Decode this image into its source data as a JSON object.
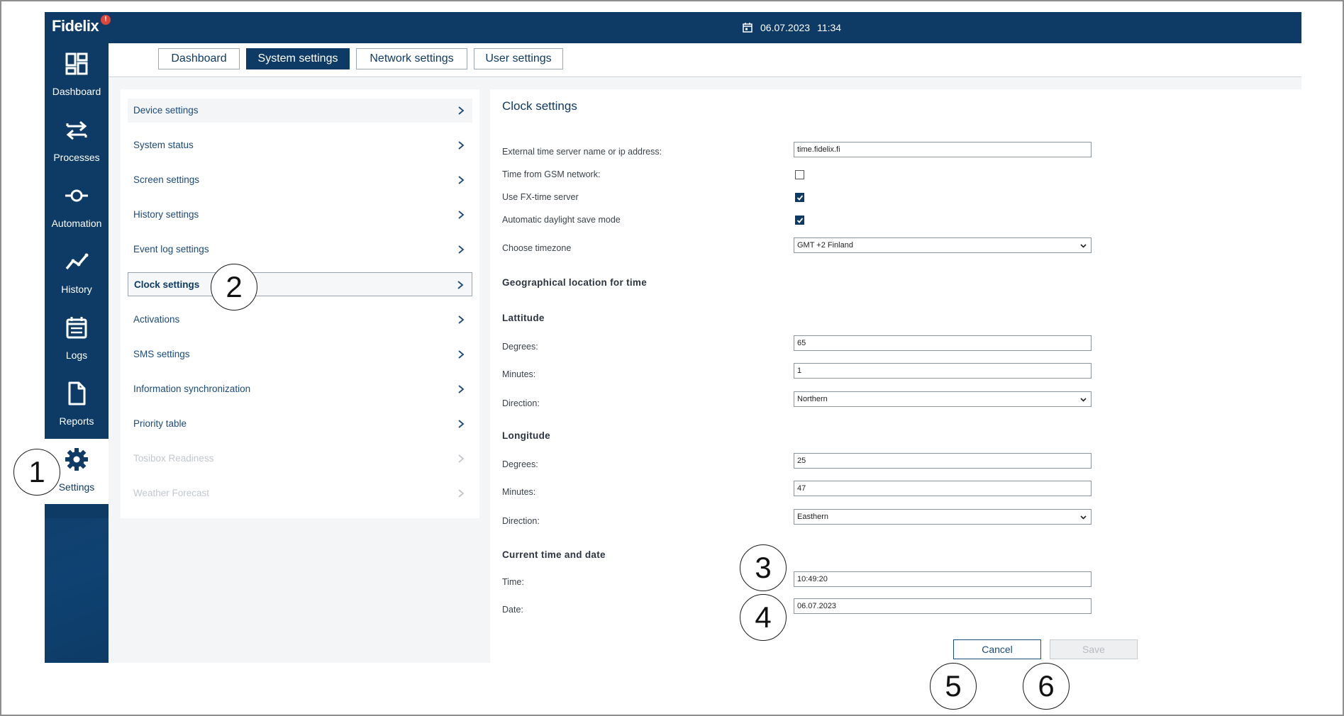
{
  "app": {
    "brand": "Fidelix",
    "alert_badge": "!",
    "date": "06.07.2023",
    "time": "11:34"
  },
  "sidebar": {
    "items": [
      {
        "label": "Dashboard",
        "icon": "dashboard-icon"
      },
      {
        "label": "Processes",
        "icon": "processes-icon"
      },
      {
        "label": "Automation",
        "icon": "automation-icon"
      },
      {
        "label": "History",
        "icon": "history-icon"
      },
      {
        "label": "Logs",
        "icon": "logs-icon"
      },
      {
        "label": "Reports",
        "icon": "reports-icon"
      },
      {
        "label": "Settings",
        "icon": "gear-icon",
        "active": true
      }
    ]
  },
  "tabs": [
    {
      "label": "Dashboard"
    },
    {
      "label": "System settings",
      "active": true
    },
    {
      "label": "Network settings"
    },
    {
      "label": "User settings"
    }
  ],
  "settings_menu": {
    "items": [
      {
        "label": "Device settings"
      },
      {
        "label": "System status"
      },
      {
        "label": "Screen settings"
      },
      {
        "label": "History settings"
      },
      {
        "label": "Event log settings"
      },
      {
        "label": "Clock settings",
        "active": true
      },
      {
        "label": "Activations"
      },
      {
        "label": "SMS settings"
      },
      {
        "label": "Information synchronization"
      },
      {
        "label": "Priority table"
      },
      {
        "label": "Tosibox Readiness",
        "disabled": true
      },
      {
        "label": "Weather Forecast",
        "disabled": true
      }
    ]
  },
  "clock": {
    "title": "Clock settings",
    "ext_server_label": "External time server name or ip address:",
    "ext_server_value": "time.fidelix.fi",
    "gsm_label": "Time from GSM network:",
    "gsm_checked": false,
    "fx_label": "Use FX-time server",
    "fx_checked": true,
    "dst_label": "Automatic daylight save mode",
    "dst_checked": true,
    "timezone_label": "Choose timezone",
    "timezone_value": "GMT +2 Finland",
    "geo_heading": "Geographical location for time",
    "lat_heading": "Lattitude",
    "lat_degrees_label": "Degrees:",
    "lat_degrees_value": "65",
    "lat_minutes_label": "Minutes:",
    "lat_minutes_value": "1",
    "lat_direction_label": "Direction:",
    "lat_direction_value": "Northern",
    "lon_heading": "Longitude",
    "lon_degrees_label": "Degrees:",
    "lon_degrees_value": "25",
    "lon_minutes_label": "Minutes:",
    "lon_minutes_value": "47",
    "lon_direction_label": "Direction:",
    "lon_direction_value": "Easthern",
    "current_heading": "Current time and date",
    "time_label": "Time:",
    "time_value": "10:49:20",
    "date_label": "Date:",
    "date_value": "06.07.2023",
    "cancel_label": "Cancel",
    "save_label": "Save"
  },
  "callouts": [
    "1",
    "2",
    "3",
    "4",
    "5",
    "6"
  ],
  "colors": {
    "brand_navy": "#0d3b66",
    "link_blue": "#1a4a7a",
    "panel_bg": "#f4f5f7",
    "disabled_text": "#c2c7cd"
  }
}
